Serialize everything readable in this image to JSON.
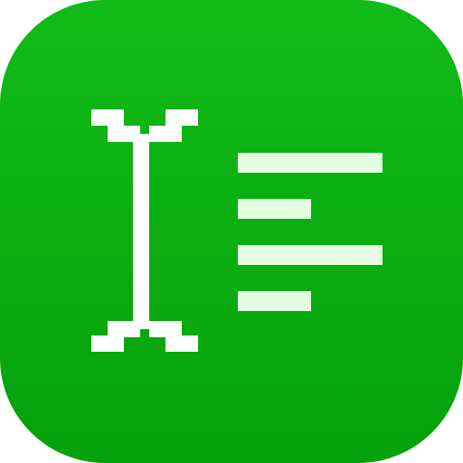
{
  "app_icon": {
    "icon_name": "text-cursor-document-icon",
    "colors": {
      "background_top": "#12bb18",
      "background_bottom": "#05a10b",
      "cursor": "#ffffff",
      "text_lines": "#e2fde0"
    },
    "text_lines": [
      {
        "name": "long-line"
      },
      {
        "name": "short-line"
      },
      {
        "name": "long-line"
      },
      {
        "name": "short-line"
      }
    ]
  }
}
